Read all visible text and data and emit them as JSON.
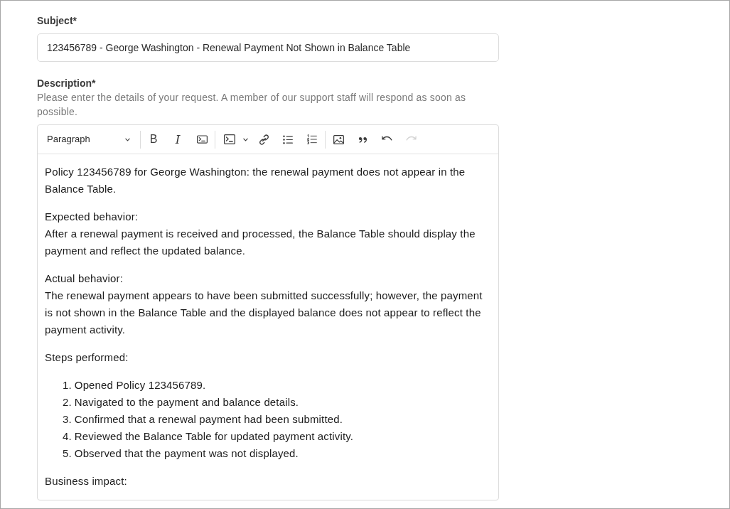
{
  "subject": {
    "label": "Subject*",
    "value": "123456789 - George Washington - Renewal Payment Not Shown in Balance Table"
  },
  "description": {
    "label": "Description*",
    "hint": "Please enter the details of your request. A member of our support staff will respond as soon as possible.",
    "editor": {
      "toolbar": {
        "block_format": "Paragraph",
        "groups": [
          {
            "buttons": [
              {
                "kind": "bold",
                "glyph": "B",
                "dropdown": false,
                "disabled": false
              },
              {
                "kind": "italic",
                "glyph": "I",
                "dropdown": false,
                "disabled": false
              },
              {
                "kind": "code",
                "dropdown": false,
                "disabled": false
              }
            ]
          },
          {
            "buttons": [
              {
                "kind": "code_block",
                "dropdown": true,
                "disabled": false
              },
              {
                "kind": "link",
                "dropdown": false,
                "disabled": false
              },
              {
                "kind": "bulleted_list",
                "dropdown": false,
                "disabled": false
              },
              {
                "kind": "numbered_list",
                "dropdown": false,
                "disabled": false
              }
            ]
          },
          {
            "buttons": [
              {
                "kind": "image",
                "dropdown": false,
                "disabled": false
              },
              {
                "kind": "quote",
                "dropdown": false,
                "disabled": false
              },
              {
                "kind": "undo",
                "dropdown": false,
                "disabled": false
              },
              {
                "kind": "redo",
                "dropdown": false,
                "disabled": true
              }
            ]
          }
        ]
      },
      "content": [
        {
          "kind": "paragraph",
          "lines": [
            "Policy 123456789 for George Washington: the renewal payment does not appear in the Balance Table."
          ]
        },
        {
          "kind": "paragraph",
          "lines": [
            "Expected behavior:",
            "After a renewal payment is received and processed, the Balance Table should display the payment and reflect the updated balance."
          ]
        },
        {
          "kind": "paragraph",
          "lines": [
            "Actual behavior:",
            "The renewal payment appears to have been submitted successfully; however, the payment is not shown in the Balance Table and the displayed balance does not appear to reflect the payment activity."
          ]
        },
        {
          "kind": "paragraph",
          "lines": [
            "Steps performed:"
          ]
        },
        {
          "kind": "ordered_list",
          "items": [
            {
              "marker": "1.",
              "text": "Opened Policy 123456789."
            },
            {
              "marker": "2.",
              "text": "Navigated to the payment and balance details."
            },
            {
              "marker": "3.",
              "text": "Confirmed that a renewal payment had been submitted."
            },
            {
              "marker": "4.",
              "text": "Reviewed the Balance Table for updated payment activity."
            },
            {
              "marker": "5.",
              "text": "Observed that the payment was not displayed."
            }
          ]
        },
        {
          "kind": "paragraph",
          "lines": [
            "Business impact:"
          ]
        }
      ]
    }
  }
}
